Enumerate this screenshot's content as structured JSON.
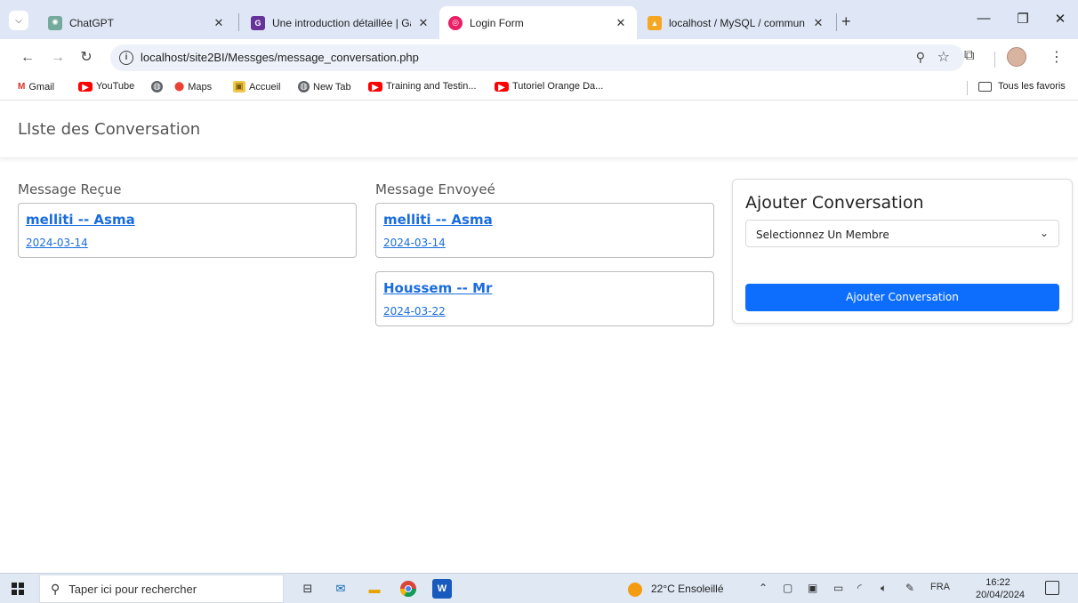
{
  "browser": {
    "tabs": [
      {
        "title": "ChatGPT",
        "favicon": "chatgpt-icon",
        "active": false
      },
      {
        "title": "Une introduction détaillée | Ga",
        "favicon": "gatsby-icon",
        "active": false
      },
      {
        "title": "Login Form",
        "favicon": "login-form-icon",
        "active": true
      },
      {
        "title": "localhost / MySQL / commun",
        "favicon": "phpmyadmin-icon",
        "active": false
      }
    ],
    "url": "localhost/site2BI/Messges/message_conversation.php",
    "bookmarks": [
      "Gmail",
      "YouTube",
      "",
      "Maps",
      "Accueil",
      "New Tab",
      "Training and Testin...",
      "Tutoriel Orange Da..."
    ],
    "all_bookmarks_label": "Tous les favoris"
  },
  "page": {
    "title": "LIste des Conversation",
    "received": {
      "heading": "Message Reçue",
      "items": [
        {
          "name": "melliti -- Asma",
          "date": "2024-03-14"
        }
      ]
    },
    "sent": {
      "heading": "Message Envoyeé",
      "items": [
        {
          "name": "melliti -- Asma",
          "date": "2024-03-14"
        },
        {
          "name": "Houssem -- Mr",
          "date": "2024-03-22"
        }
      ]
    },
    "add_panel": {
      "title": "Ajouter Conversation",
      "select_value": "Selectionnez Un Membre",
      "button_label": "Ajouter Conversation"
    }
  },
  "taskbar": {
    "search_placeholder": "Taper ici pour rechercher",
    "weather": "22°C Ensoleillé",
    "language": "FRA",
    "time": "16:22",
    "date": "20/04/2024"
  },
  "colors": {
    "link": "#1a6ddc",
    "primary_button": "#0d6efd",
    "tabstrip": "#dfe7f6"
  }
}
